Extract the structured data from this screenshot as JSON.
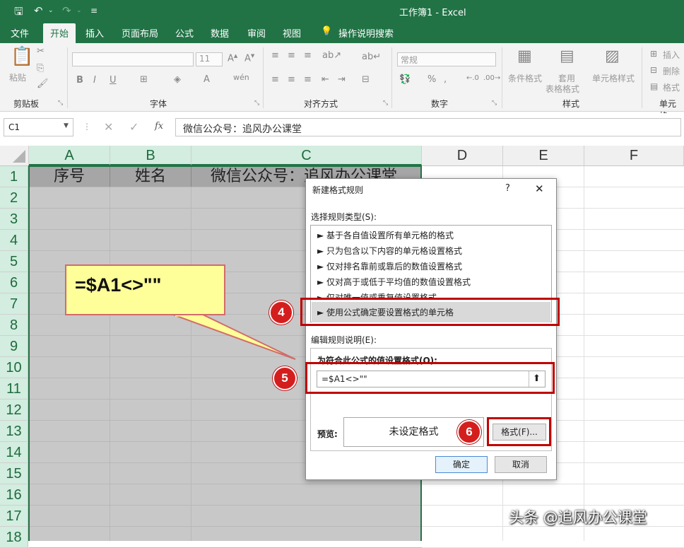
{
  "titlebar": {
    "title": "工作簿1  -  Excel"
  },
  "tabs": [
    "文件",
    "开始",
    "插入",
    "页面布局",
    "公式",
    "数据",
    "审阅",
    "视图",
    "操作说明搜索"
  ],
  "ribbon": {
    "groups": {
      "clipboard": "剪贴板",
      "font": "字体",
      "alignment": "对齐方式",
      "number": "数字",
      "styles": "样式",
      "cells": "单元格"
    },
    "paste": "粘贴",
    "font_size": "11",
    "number_format": "常规",
    "cond_format": "条件格式",
    "format_table": [
      "套用",
      "表格格式"
    ],
    "cell_styles": "单元格样式",
    "insert": "插入",
    "delete": "删除",
    "format": "格式"
  },
  "formula_bar": {
    "name_box": "C1",
    "fx": "fx",
    "value": "微信公众号：追风办公课堂"
  },
  "columns": [
    "A",
    "B",
    "C",
    "D",
    "E",
    "F"
  ],
  "rows": [
    "1",
    "2",
    "3",
    "4",
    "5",
    "6",
    "7",
    "8",
    "9",
    "10",
    "11",
    "12",
    "13",
    "14",
    "15",
    "16",
    "17",
    "18"
  ],
  "cells": {
    "A1": "序号",
    "B1": "姓名",
    "C1": "微信公众号：追风办公课堂"
  },
  "callout": {
    "text": "=$A1<>\"\""
  },
  "dialog": {
    "title": "新建格式规则",
    "help": "?",
    "close": "✕",
    "select_type_label": "选择规则类型(S):",
    "rule_types": [
      "► 基于各自值设置所有单元格的格式",
      "► 只为包含以下内容的单元格设置格式",
      "► 仅对排名靠前或靠后的数值设置格式",
      "► 仅对高于或低于平均值的数值设置格式",
      "► 仅对唯一值或重复值设置格式",
      "► 使用公式确定要设置格式的单元格"
    ],
    "edit_label": "编辑规则说明(E):",
    "formula_label": "为符合此公式的值设置格式(O):",
    "formula_value": "=$A1<>\"\"",
    "preview_label": "预览:",
    "preview_text": "未设定格式",
    "format_button": "格式(F)...",
    "ok": "确定",
    "cancel": "取消"
  },
  "badges": [
    "4",
    "5",
    "6"
  ],
  "watermark": "头条 @追风办公课堂"
}
